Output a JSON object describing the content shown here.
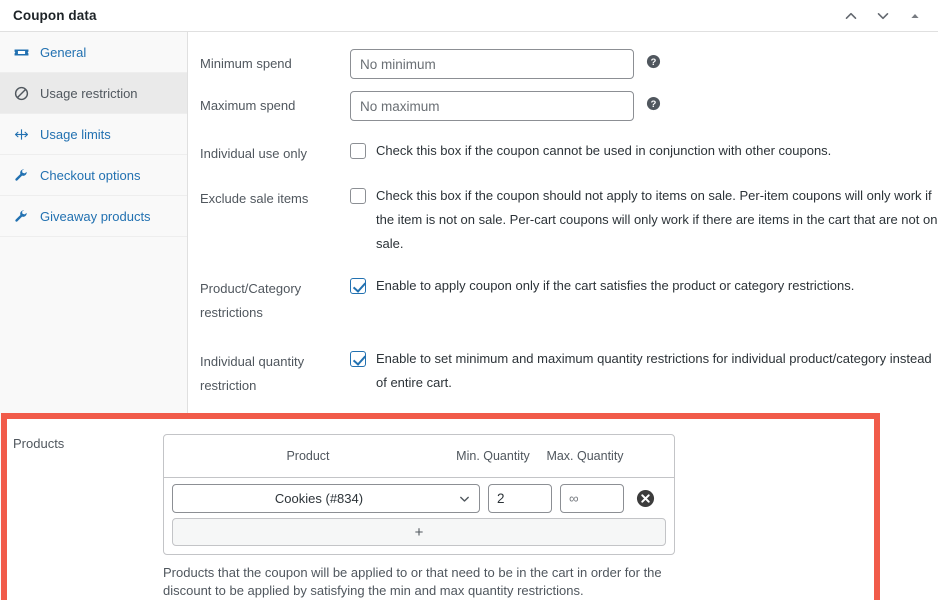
{
  "header": {
    "title": "Coupon data",
    "actions": [
      {
        "name": "move-up-button",
        "icon": "chevron-up-icon"
      },
      {
        "name": "move-down-button",
        "icon": "chevron-down-icon"
      },
      {
        "name": "collapse-panel-button",
        "icon": "triangle-up-icon"
      }
    ]
  },
  "sidebar": {
    "items": [
      {
        "label": "General",
        "icon": "ticket-icon",
        "active": false
      },
      {
        "label": "Usage restriction",
        "icon": "no-entry-icon",
        "active": true
      },
      {
        "label": "Usage limits",
        "icon": "limits-icon",
        "active": false
      },
      {
        "label": "Checkout options",
        "icon": "wrench-icon",
        "active": false
      },
      {
        "label": "Giveaway products",
        "icon": "wrench-icon",
        "active": false
      }
    ]
  },
  "fields": {
    "minimum_spend": {
      "label": "Minimum spend",
      "placeholder": "No minimum",
      "value": ""
    },
    "maximum_spend": {
      "label": "Maximum spend",
      "placeholder": "No maximum",
      "value": ""
    },
    "individual_use": {
      "label": "Individual use only",
      "description": "Check this box if the coupon cannot be used in conjunction with other coupons.",
      "checked": false
    },
    "exclude_sale_items": {
      "label": "Exclude sale items",
      "description": "Check this box if the coupon should not apply to items on sale. Per-item coupons will only work if the item is not on sale. Per-cart coupons will only work if there are items in the cart that are not on sale.",
      "checked": false
    },
    "product_category_restrictions": {
      "label": "Product/Category restrictions",
      "description": "Enable to apply coupon only if the cart satisfies the product or category restrictions.",
      "checked": true
    },
    "individual_quantity_restriction": {
      "label": "Individual quantity restriction",
      "description": "Enable to set minimum and maximum quantity restrictions for individual product/category instead of entire cart.",
      "checked": true
    }
  },
  "products_section": {
    "label": "Products",
    "columns": {
      "product": "Product",
      "min_quantity": "Min. Quantity",
      "max_quantity": "Max. Quantity"
    },
    "rows": [
      {
        "product": "Cookies (#834)",
        "min_quantity": "2",
        "max_quantity": "",
        "max_quantity_placeholder": "∞"
      }
    ],
    "add_row_label": "+",
    "description": "Products that the coupon will be applied to or that need to be in the cart in order for the discount to be applied by satisfying the min and max quantity restrictions.",
    "highlight_color": "#f15b4a"
  },
  "colors": {
    "link": "#2271b1",
    "text": "#2c3338",
    "muted": "#50575e",
    "border": "#c3c4c7",
    "sidebar_bg": "#f9f9f9",
    "active_bg": "#eaeaea"
  }
}
